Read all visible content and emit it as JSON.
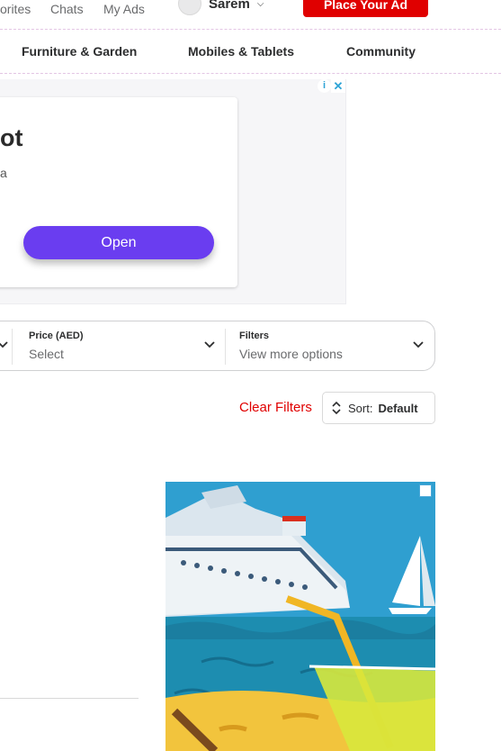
{
  "topnav": {
    "favorites_label": "orites",
    "chats_label": "Chats",
    "myads_label": "My Ads",
    "user_name": "Sarem",
    "place_ad_label": "Place Your Ad"
  },
  "categories": [
    {
      "label": "Furniture & Garden"
    },
    {
      "label": "Mobiles & Tablets"
    },
    {
      "label": "Community"
    }
  ],
  "top_ad": {
    "title": "ot",
    "subtitle": "a",
    "open_label": "Open"
  },
  "filters": {
    "price_label": "Price (AED)",
    "price_value": "Select",
    "filters_label": "Filters",
    "filters_value": "View more options"
  },
  "actions": {
    "clear_label": "Clear Filters",
    "sort_prefix": "Sort:",
    "sort_value": "Default"
  },
  "colors": {
    "brand_red": "#e00000",
    "ad_button_purple": "#6a3df0"
  }
}
